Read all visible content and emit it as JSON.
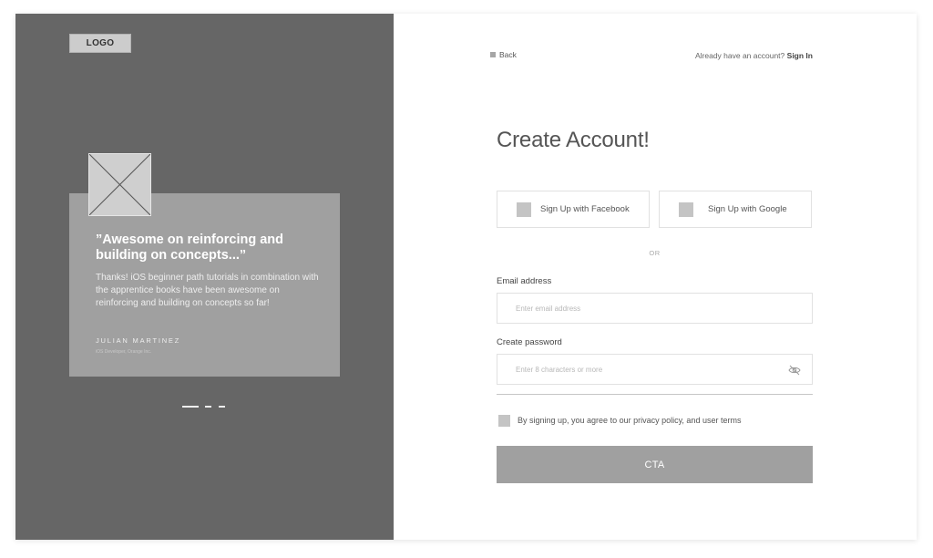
{
  "brand": {
    "logo_text": "LOGO"
  },
  "testimonial": {
    "quote": "”Awesome on reinforcing and building on concepts...”",
    "body": "Thanks! iOS beginner path tutorials in combination with the apprentice books have been awesome on reinforcing and building on concepts so far!",
    "author": "JULIAN MARTINEZ",
    "author_role": "iOS Developer, Orange Inc.",
    "carousel_pages": 3,
    "carousel_active": 1
  },
  "nav": {
    "back_label": "Back",
    "account_prompt": "Already have an account?",
    "signin_label": "Sign In"
  },
  "form": {
    "title": "Create Account!",
    "facebook_label": "Sign Up with Facebook",
    "google_label": "Sign Up with Google",
    "divider_text": "OR",
    "email_label": "Email address",
    "email_placeholder": "Enter email address",
    "email_value": "",
    "password_label": "Create password",
    "password_placeholder": "Enter 8 characters or more",
    "password_value": "",
    "terms_text": "By signing up, you agree to our privacy policy, and user terms",
    "terms_checked": false,
    "cta_label": "CTA"
  },
  "icons": {
    "avatar": "image-placeholder-icon",
    "password_toggle": "eye-slash-icon",
    "back": "back-icon",
    "facebook": "facebook-icon",
    "google": "google-icon"
  },
  "colors": {
    "left_panel_bg": "#666666",
    "card_bg": "#a0a0a0",
    "cta_bg": "#a0a0a0",
    "placeholder_fill": "#c4c4c4"
  }
}
